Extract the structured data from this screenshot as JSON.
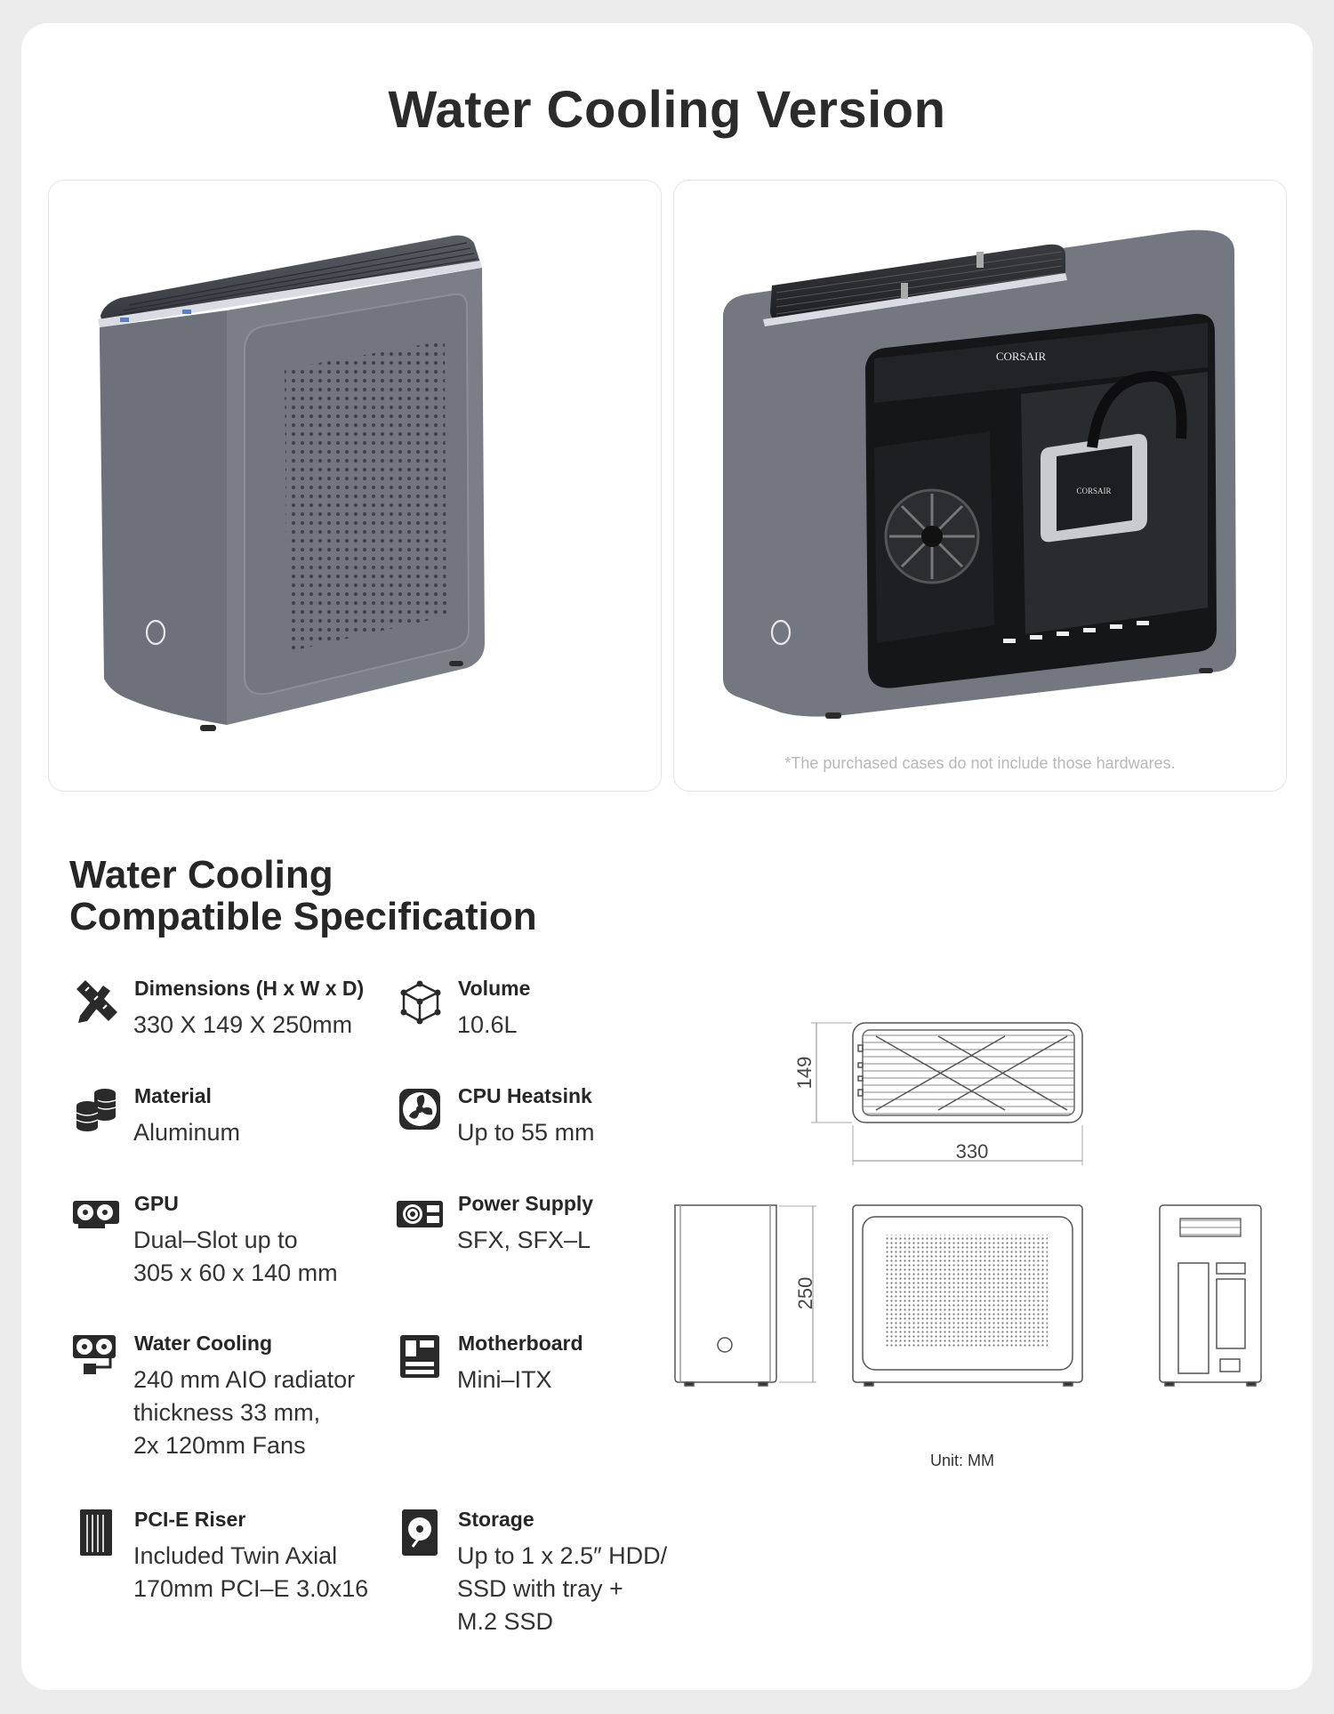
{
  "title": "Water Cooling Version",
  "panels": {
    "right_brand_top": "CORSAIR",
    "right_brand_pump": "CORSAIR",
    "disclaimer": "*The purchased cases do not include those hardwares."
  },
  "spec_title_line1": "Water Cooling",
  "spec_title_line2": "Compatible Specification",
  "specs": {
    "dimensions": {
      "label": "Dimensions (H x W x D)",
      "value": "330 X 149 X 250mm",
      "icon": "ruler-pencil-icon"
    },
    "volume": {
      "label": "Volume",
      "value": "10.6L",
      "icon": "cube-icon"
    },
    "material": {
      "label": "Material",
      "value": "Aluminum",
      "icon": "coin-stack-icon"
    },
    "cpu_heatsink": {
      "label": "CPU Heatsink",
      "value": "Up to 55 mm",
      "icon": "fan-icon"
    },
    "gpu": {
      "label": "GPU",
      "value_line1": "Dual–Slot up to",
      "value_line2": "305 x 60 x 140 mm",
      "icon": "gpu-icon"
    },
    "power_supply": {
      "label": "Power Supply",
      "value": "SFX, SFX–L",
      "icon": "psu-icon"
    },
    "water_cooling": {
      "label": "Water Cooling",
      "value_line1": "240 mm AIO radiator",
      "value_line2": "thickness 33 mm,",
      "value_line3": "2x 120mm Fans",
      "icon": "radiator-icon"
    },
    "motherboard": {
      "label": "Motherboard",
      "value": "Mini–ITX",
      "icon": "motherboard-icon"
    },
    "pcie_riser": {
      "label": "PCI-E Riser",
      "value_line1": "Included Twin Axial",
      "value_line2": "170mm PCI–E 3.0x16",
      "icon": "riser-cable-icon"
    },
    "storage": {
      "label": "Storage",
      "value_line1": "Up to 1 x 2.5″ HDD/",
      "value_line2": "SSD with tray +",
      "value_line3": "M.2 SSD",
      "icon": "hard-drive-icon"
    }
  },
  "drawing": {
    "top_depth": "149",
    "top_width": "330",
    "front_height": "250",
    "unit": "Unit: MM"
  }
}
